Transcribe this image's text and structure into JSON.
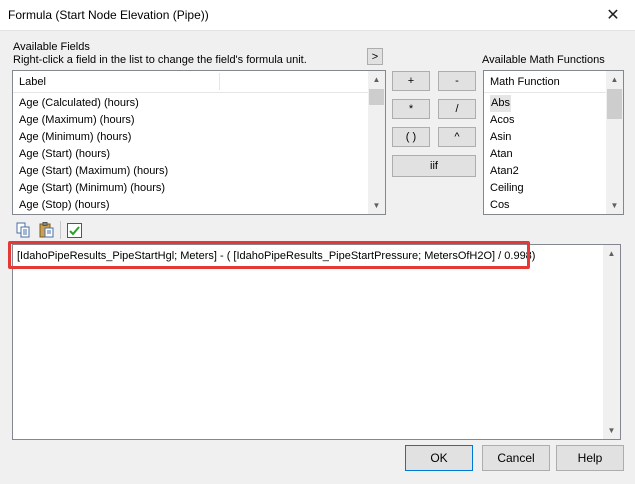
{
  "window": {
    "title": "Formula (Start Node Elevation (Pipe))",
    "close_glyph": "✕"
  },
  "fields": {
    "heading": "Available Fields",
    "hint": "Right-click a field in the list to change the field's formula unit.",
    "expand_glyph": ">",
    "column_header": "Label",
    "items": [
      "Age (Calculated) (hours)",
      "Age (Maximum) (hours)",
      "Age (Minimum) (hours)",
      "Age (Start) (hours)",
      "Age (Start) (Maximum) (hours)",
      "Age (Start) (Minimum) (hours)",
      "Age (Stop) (hours)"
    ]
  },
  "operators": {
    "plus": "+",
    "minus": "-",
    "multiply": "*",
    "divide": "/",
    "parens": "( )",
    "power": "^",
    "iif": "iif"
  },
  "functions": {
    "heading": "Available Math Functions",
    "column_header": "Math Function",
    "items": [
      "Abs",
      "Acos",
      "Asin",
      "Atan",
      "Atan2",
      "Ceiling",
      "Cos"
    ],
    "selected": "Abs"
  },
  "toolbar": {
    "icons": [
      "copy-icon",
      "paste-icon",
      "validate-check-icon"
    ]
  },
  "editor": {
    "formula": "[IdahoPipeResults_PipeStartHgl; Meters] - ( [IdahoPipeResults_PipeStartPressure; MetersOfH2O] / 0.998)"
  },
  "buttons": {
    "ok": "OK",
    "cancel": "Cancel",
    "help": "Help"
  },
  "colors": {
    "highlight": "#e53935",
    "check": "#2e9e2e"
  }
}
